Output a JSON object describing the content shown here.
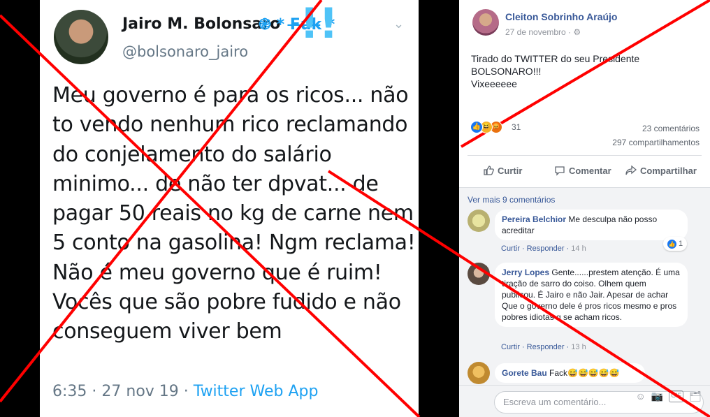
{
  "tweet": {
    "name": "Jairo M. Bolonsaro",
    "name_suffix": "֎ * F̶u̶k̶ *",
    "bang": "!!",
    "handle": "@bolsonaro_jairo",
    "text": "Meu governo é para os ricos... não to vendo nenhum rico reclamando do conjelamento do salário minimo... de não ter dpvat... de pagar 50 reais no kg de carne nem 5 conto na gasolina! Ngm reclama! Não é meu governo que é ruim! Vocês que são pobre fudido e não conseguem viver bem",
    "meta_time": "6:35 · 27 nov 19 · ",
    "meta_source": "Twitter Web App",
    "chevron": "⌄"
  },
  "facebook": {
    "author": "Cleiton Sobrinho Araújo",
    "date": "27 de novembro · ⚙",
    "post_text": "Tirado do TWITTER do seu Presidente\nBOLSONARO!!!\nVixeeeeee",
    "reaction_count": "31",
    "comments_count": "23 comentários",
    "shares_count": "297 compartilhamentos",
    "actions": {
      "like": "Curtir",
      "comment": "Comentar",
      "share": "Compartilhar"
    },
    "more_comments": "Ver mais 9 comentários",
    "comments": [
      {
        "name": "Pereira Belchior",
        "text": "Me desculpa não posso acreditar",
        "like": "Curtir",
        "reply": "Responder",
        "time": "14 h",
        "reactions": "1"
      },
      {
        "name": "Jerry Lopes",
        "text": "Gente......prestem atenção. É uma tiração de sarro do coiso. Olhem quem publicou. É Jairo e não Jair. Apesar de achar Que o governo dele é pros ricos mesmo e pros pobres idiotas q se acham ricos.",
        "like": "Curtir",
        "reply": "Responder",
        "time": "13 h"
      },
      {
        "name": "Gorete Bau",
        "text": "Fack😅😅😅😅😅"
      }
    ],
    "input_placeholder": "Escreva um comentário...",
    "input_icons": [
      "☺",
      "📷",
      "GIF",
      "🗂"
    ]
  },
  "colors": {
    "cross": "#ff0000",
    "link": "#385898",
    "twitter_blue": "#1da1f2"
  }
}
